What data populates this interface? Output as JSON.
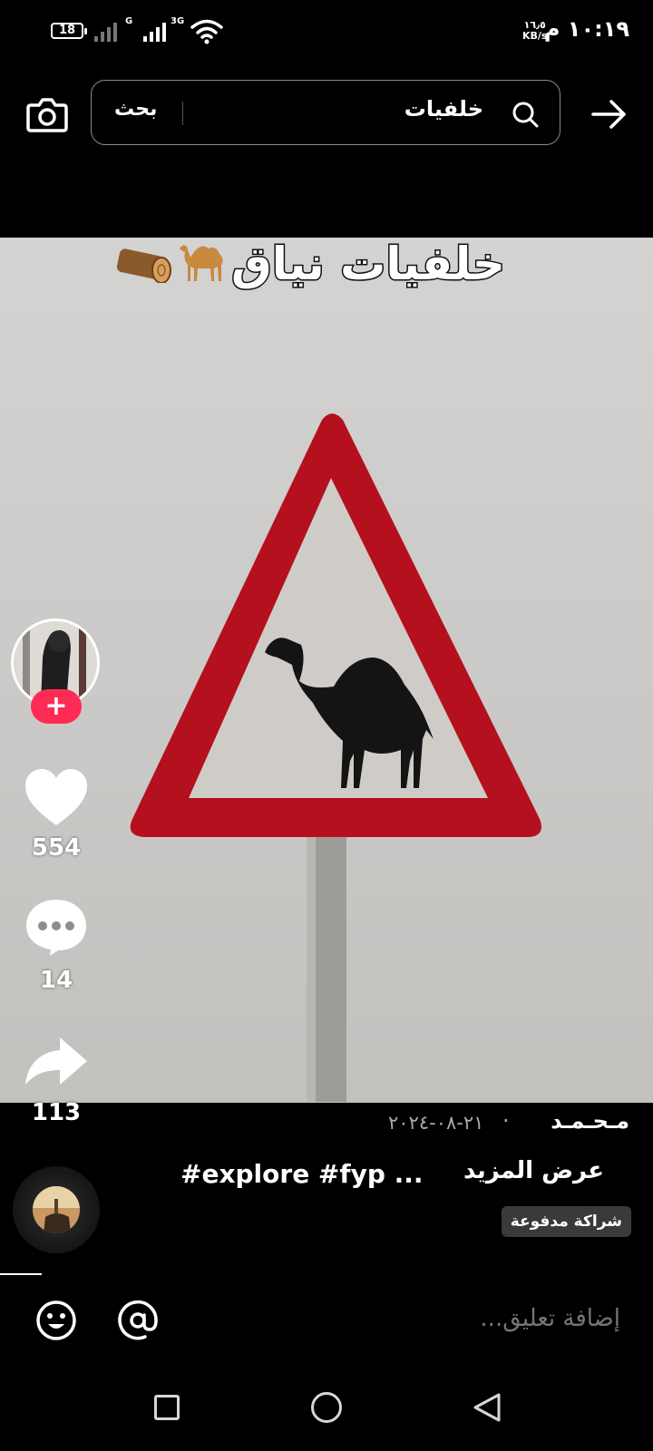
{
  "status_bar": {
    "time": "١٠:١٩ م",
    "battery": "18",
    "net_speed_value": "١٦٫٥",
    "net_speed_unit": "KB/s",
    "signal_1_label": "G",
    "signal_2_label": "3G"
  },
  "search": {
    "query": "خلفيات",
    "button_label": "بحث"
  },
  "video": {
    "overlay_title": "خلفيات نياق"
  },
  "actions": {
    "likes": "554",
    "comments": "14",
    "shares": "113"
  },
  "caption": {
    "author": "مـحـمـد",
    "date": "٢١-٠٨-٢٠٢٤",
    "hashtags": "#explore #fyp ...",
    "see_more": "عرض المزيد",
    "paid_partnership": "شراكة مدفوعة"
  },
  "comment_bar": {
    "placeholder": "إضافة تعليق..."
  },
  "colors": {
    "accent": "#fe2c55",
    "sign_red": "#b5101d",
    "background": "#000000"
  }
}
